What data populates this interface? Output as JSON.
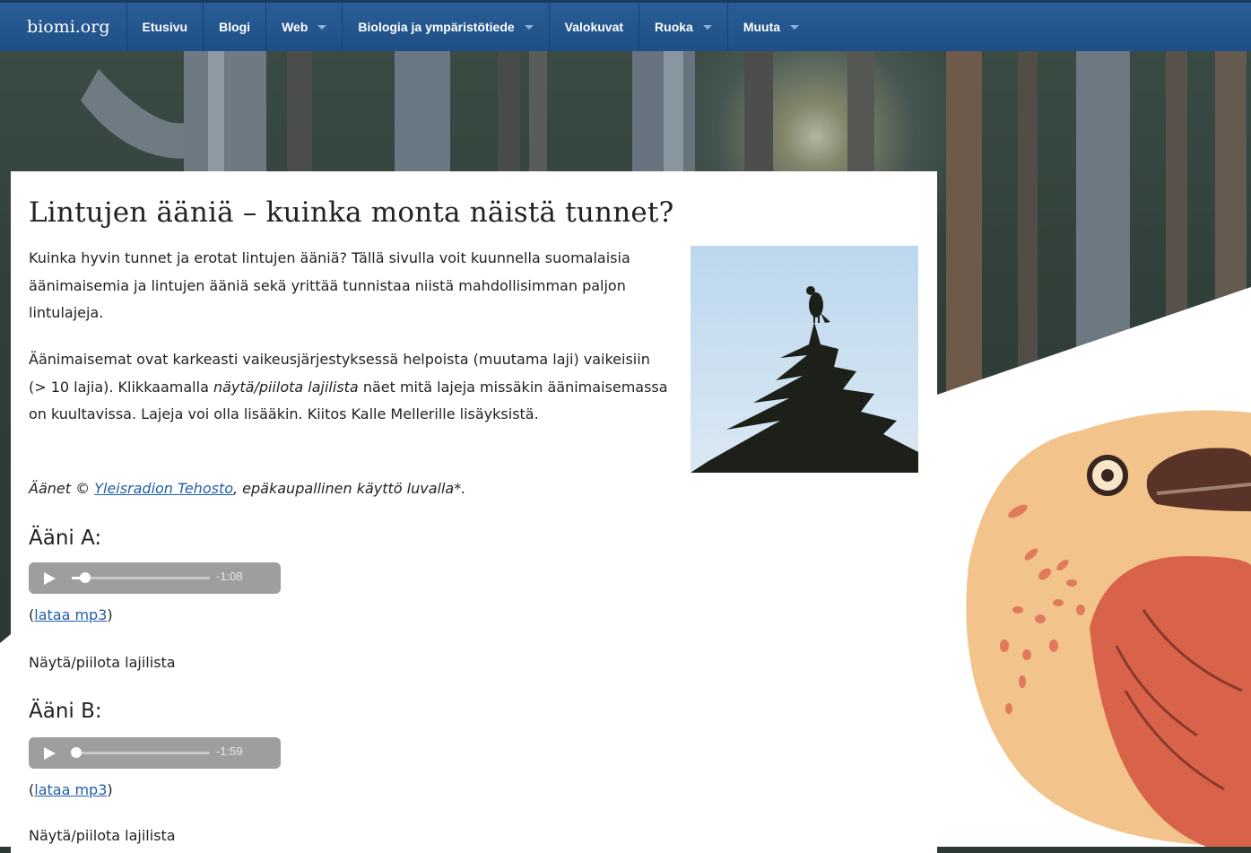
{
  "navbar": {
    "brand": "biomi.org",
    "items": [
      {
        "label": "Etusivu",
        "dropdown": false
      },
      {
        "label": "Blogi",
        "dropdown": false
      },
      {
        "label": "Web",
        "dropdown": true
      },
      {
        "label": "Biologia ja ympäristötiede",
        "dropdown": true
      },
      {
        "label": "Valokuvat",
        "dropdown": false
      },
      {
        "label": "Ruoka",
        "dropdown": true
      },
      {
        "label": "Muuta",
        "dropdown": true
      }
    ]
  },
  "article": {
    "title": "Lintujen ääniä – kuinka monta näistä tunnet?",
    "intro1": "Kuinka hyvin tunnet ja erotat lintujen ääniä? Tällä sivulla voit kuunnella suomalaisia äänimaisemia ja lintujen ääniä sekä yrittää tunnistaa niistä mahdollisimman paljon lintulajeja.",
    "intro2_before": "Äänimaisemat ovat karkeasti vaikeusjärjestyksessä helpoista (muutama laji) vaikeisiin (> 10 lajia). Klikkaamalla ",
    "intro2_em": "näytä/piilota lajilista",
    "intro2_after": " näet mitä lajeja missäkin äänimaisemassa on kuultavissa. Lajeja voi olla lisääkin. Kiitos Kalle Mellerille lisäyksistä.",
    "credit_before": "Äänet © ",
    "credit_link": "Yleisradion Tehosto",
    "credit_after": ", epäkaupallinen käyttö luvalla*."
  },
  "sounds": [
    {
      "title": "Ääni A:",
      "time": "-1:08",
      "progress": 0.1,
      "download_open": "(",
      "download_label": "lataa mp3",
      "download_close": ")",
      "toggle": "Näytä/piilota lajilista"
    },
    {
      "title": "Ääni B:",
      "time": "-1:59",
      "progress": 0.03,
      "download_open": "(",
      "download_label": "lataa mp3",
      "download_close": ")",
      "toggle": "Näytä/piilota lajilista"
    }
  ],
  "colors": {
    "navbar": "#2a5d97",
    "link": "#1f5fa8",
    "player": "#9e9e9e"
  }
}
